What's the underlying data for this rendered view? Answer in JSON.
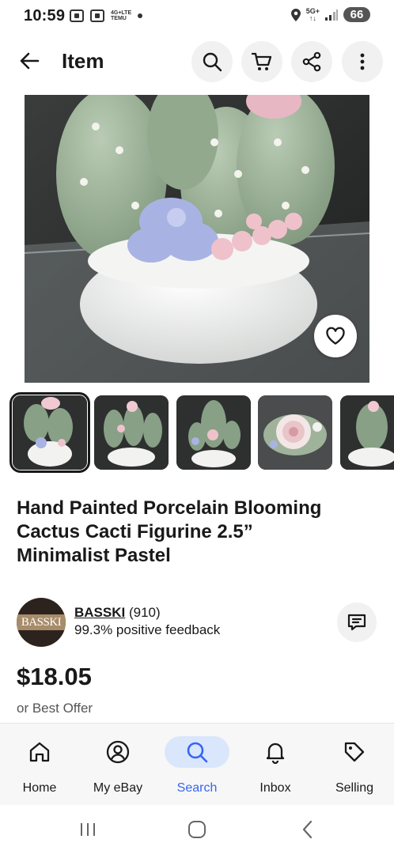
{
  "status_bar": {
    "time": "10:59",
    "notif_text_top": "4G+LTE",
    "notif_text_bottom": "TEMU",
    "network": "5G+",
    "network_sub": "↑↓",
    "battery": "66"
  },
  "header": {
    "title": "Item"
  },
  "item": {
    "title_lines": [
      "Hand Painted Porcelain Blooming",
      "Cactus Cacti Figurine 2.5”",
      "Minimalist Pastel"
    ],
    "price": "$18.05",
    "offer_text": "or Best Offer"
  },
  "seller": {
    "avatar_text": "BASSKI",
    "name": "BASSKI",
    "rating_count": " (910)",
    "feedback": "99.3% positive feedback"
  },
  "bottom_nav": {
    "items": [
      {
        "label": "Home",
        "icon": "home-icon"
      },
      {
        "label": "My eBay",
        "icon": "user-icon"
      },
      {
        "label": "Search",
        "icon": "search-icon"
      },
      {
        "label": "Inbox",
        "icon": "bell-icon"
      },
      {
        "label": "Selling",
        "icon": "tag-icon"
      }
    ],
    "active": "Search"
  },
  "colors": {
    "accent": "#3665f3",
    "active_nav_bg": "#d9e6fb",
    "text": "#191919"
  }
}
